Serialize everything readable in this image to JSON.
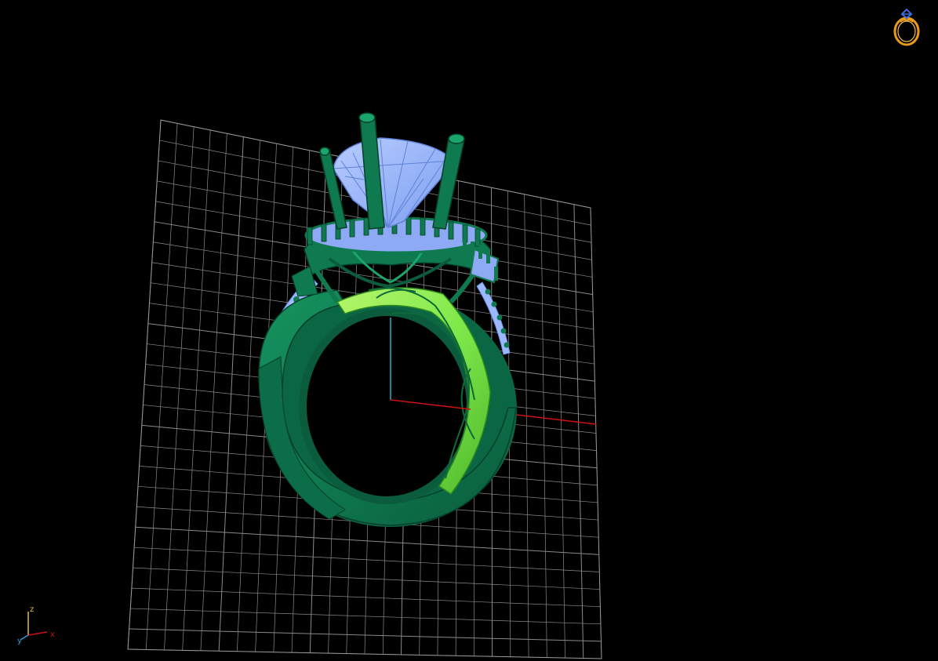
{
  "viewport": {
    "background": "#000000",
    "grid_color": "#8a8a8a",
    "x_axis_color": "#d01010",
    "z_axis_color": "#10b8c8"
  },
  "model": {
    "metal_color": "#0f7a50",
    "metal_highlight": "#1aa56b",
    "inner_surface_color": "#7ee84a",
    "gem_color": "#9cb8ff"
  },
  "axis_triad": {
    "z_label": "z",
    "y_label": "y",
    "x_label": "x"
  },
  "logo": {
    "icon": "ring-icon",
    "ring_color": "#e89a1a",
    "gem_color": "#3b6fe0"
  }
}
